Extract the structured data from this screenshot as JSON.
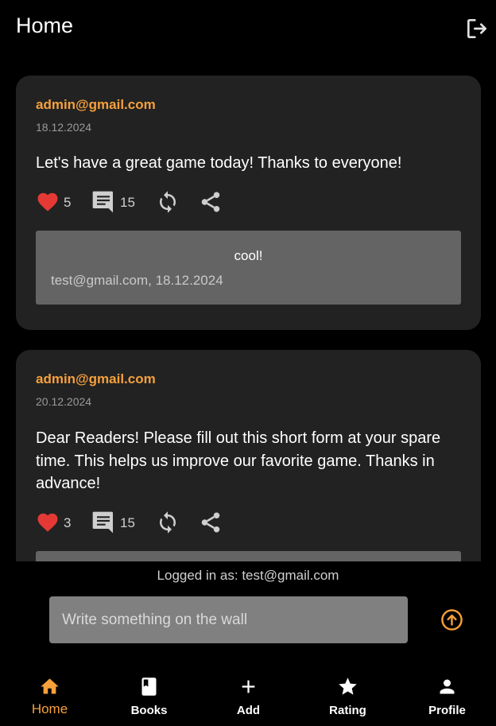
{
  "appbar": {
    "title": "Home",
    "logout_icon": "logout-icon"
  },
  "posts": [
    {
      "author": "admin@gmail.com",
      "date": "18.12.2024",
      "message": "Let's have a great game today! Thanks to everyone!",
      "likes": "5",
      "comments": "15",
      "comment": {
        "text": "cool!",
        "meta": "test@gmail.com, 18.12.2024"
      }
    },
    {
      "author": "admin@gmail.com",
      "date": "20.12.2024",
      "message": "Dear Readers! Please fill out this short form at your spare time. This helps us improve our favorite game. Thanks in advance!",
      "likes": "3",
      "comments": "15"
    }
  ],
  "footer": {
    "logged_in": "Logged in as: test@gmail.com",
    "input_placeholder": "Write something on the wall",
    "send_icon": "arrow-up-circle-icon"
  },
  "nav": [
    {
      "label": "Home",
      "icon": "home-icon",
      "active": true
    },
    {
      "label": "Books",
      "icon": "book-icon"
    },
    {
      "label": "Add",
      "icon": "plus-icon"
    },
    {
      "label": "Rating",
      "icon": "star-icon"
    },
    {
      "label": "Profile",
      "icon": "person-icon"
    }
  ],
  "colors": {
    "accent": "#f6a03c",
    "like": "#e53935",
    "card": "#222222",
    "comment_bg": "#646464"
  }
}
